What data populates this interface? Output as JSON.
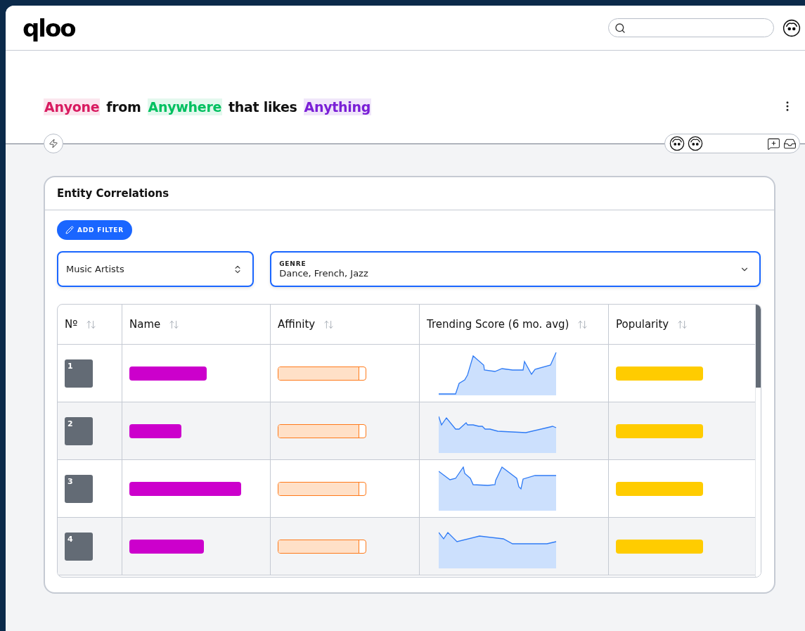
{
  "header": {
    "logo": "qloo"
  },
  "title": [
    {
      "text": "Anyone",
      "kind": "chip",
      "color": "#d81b60"
    },
    {
      "text": "from",
      "kind": "word"
    },
    {
      "text": "Anywhere",
      "kind": "chip",
      "color": "#00c060"
    },
    {
      "text": "that likes",
      "kind": "word"
    },
    {
      "text": "Anything",
      "kind": "chip",
      "color": "#7a1fd6"
    }
  ],
  "card": {
    "title": "Entity Correlations",
    "add_filter": "ADD FILTER",
    "type_select": {
      "value": "Music Artists"
    },
    "genre_select": {
      "label": "GENRE",
      "value": "Dance, French, Jazz"
    },
    "table": {
      "columns": [
        "Nº",
        "Name",
        "Affinity",
        "Trending Score (6 mo. avg)",
        "Popularity"
      ],
      "rows": [
        {
          "rank": "1",
          "affinity": {
            "level": 0.93
          }
        },
        {
          "rank": "2",
          "affinity": {
            "level": 0.93
          }
        },
        {
          "rank": "3",
          "affinity": {
            "level": 0.93
          }
        },
        {
          "rank": "4",
          "affinity": {
            "level": 0.93
          }
        }
      ]
    }
  }
}
